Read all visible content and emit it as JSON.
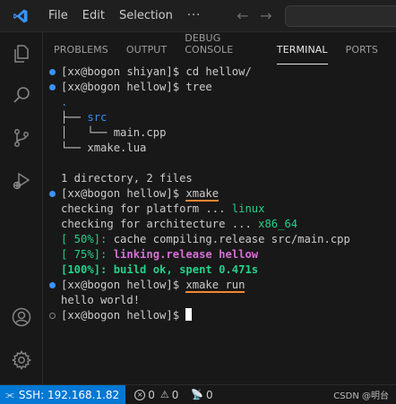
{
  "menu": {
    "file": "File",
    "edit": "Edit",
    "selection": "Selection",
    "more": "···"
  },
  "nav": {
    "back": "←",
    "forward": "→"
  },
  "tabs": [
    "PROBLEMS",
    "OUTPUT",
    "DEBUG CONSOLE",
    "TERMINAL",
    "PORTS"
  ],
  "active_tab": "TERMINAL",
  "terminal": {
    "l1_prompt": "[xx@bogon shiyan]$ ",
    "l1_cmd": "cd hellow/",
    "l2_prompt": "[xx@bogon hellow]$ ",
    "l2_cmd": "tree",
    "tree_root": ".",
    "tree_src_branch": "├── ",
    "tree_src": "src",
    "tree_main_branch": "│   └── ",
    "tree_main": "main.cpp",
    "tree_lua_branch": "└── ",
    "tree_lua": "xmake.lua",
    "summary": "1 directory, 2 files",
    "l3_prompt": "[xx@bogon hellow]$ ",
    "l3_cmd": "xmake",
    "platform_text": "checking for platform ... ",
    "platform_val": "linux",
    "arch_text": "checking for architecture ... ",
    "arch_val": "x86_64",
    "p50_tag": "[ 50%]:",
    "p50_text": " cache compiling.release src/main.cpp",
    "p75_tag": "[ 75%]:",
    "p75_text": " linking.release hellow",
    "p100": "[100%]: build ok, spent 0.471s",
    "l4_prompt": "[xx@bogon hellow]$ ",
    "l4_cmd": "xmake run",
    "output": "hello world!",
    "l5_prompt": "[xx@bogon hellow]$ "
  },
  "status": {
    "remote": "SSH: 192.168.1.82",
    "errors": "0",
    "warnings": "0",
    "ports": "0",
    "watermark": "CSDN @明台"
  },
  "colors": {
    "accent": "#0078d4",
    "green": "#23d18b",
    "magenta": "#d670d6",
    "blue_dir": "#3b8eea",
    "underline": "#f48731"
  }
}
